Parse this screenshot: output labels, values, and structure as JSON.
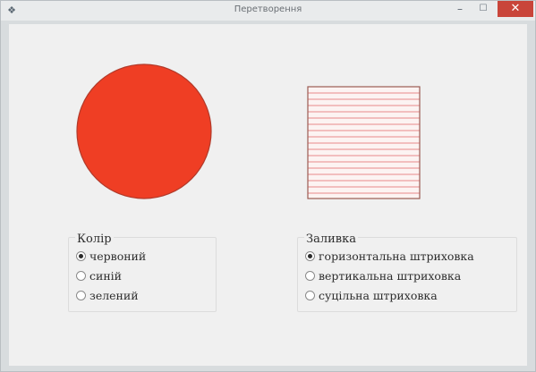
{
  "window": {
    "title": "Перетворення",
    "icon": "app-icon",
    "minimize_glyph": "–",
    "maximize_glyph": "☐",
    "close_glyph": "✕"
  },
  "color_group": {
    "title": "Колір",
    "options": [
      {
        "label": "червоний",
        "selected": true
      },
      {
        "label": "синій",
        "selected": false
      },
      {
        "label": "зелений",
        "selected": false
      }
    ]
  },
  "fill_group": {
    "title": "Заливка",
    "options": [
      {
        "label": "горизонтальна штриховка",
        "selected": true
      },
      {
        "label": "вертикальна штриховка",
        "selected": false
      },
      {
        "label": "суцільна штриховка",
        "selected": false
      }
    ]
  },
  "colors": {
    "circle_fill": "#ef3e24",
    "circle_stroke": "#b23a2a",
    "hatch_line": "#e9888a",
    "square_stroke": "#9a5a52",
    "square_bg": "#fcf3f2"
  }
}
